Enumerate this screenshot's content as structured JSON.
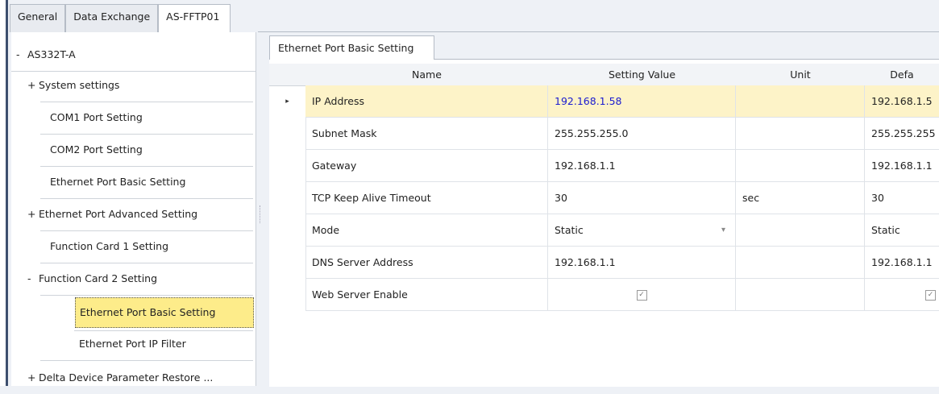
{
  "tabs": [
    "General",
    "Data Exchange",
    "AS-FFTP01"
  ],
  "tree": {
    "items": [
      {
        "prefix": "-",
        "label": "AS332T-A"
      },
      {
        "prefix": "+",
        "label": "System settings"
      },
      {
        "prefix": "",
        "label": "COM1 Port Setting"
      },
      {
        "prefix": "",
        "label": "COM2 Port Setting"
      },
      {
        "prefix": "",
        "label": "Ethernet Port Basic Setting"
      },
      {
        "prefix": "+",
        "label": "Ethernet Port Advanced Setting"
      },
      {
        "prefix": "",
        "label": "Function Card 1 Setting"
      },
      {
        "prefix": "-",
        "label": "Function Card 2 Setting"
      },
      {
        "prefix": "",
        "label": "Ethernet Port Basic Setting"
      },
      {
        "prefix": "",
        "label": "Ethernet Port IP Filter"
      },
      {
        "prefix": "+",
        "label": "Delta Device Parameter Restore ..."
      }
    ]
  },
  "panel": {
    "tab_label": "Ethernet Port Basic Setting",
    "columns": [
      "Name",
      "Setting Value",
      "Unit",
      "Defa"
    ],
    "rows": [
      {
        "name": "IP Address",
        "value": "192.168.1.58",
        "unit": "",
        "default": "192.168.1.5"
      },
      {
        "name": "Subnet Mask",
        "value": "255.255.255.0",
        "unit": "",
        "default": "255.255.255"
      },
      {
        "name": "Gateway",
        "value": "192.168.1.1",
        "unit": "",
        "default": "192.168.1.1"
      },
      {
        "name": "TCP Keep Alive Timeout",
        "value": "30",
        "unit": "sec",
        "default": "30"
      },
      {
        "name": "Mode",
        "value": "Static",
        "unit": "",
        "default": "Static"
      },
      {
        "name": "DNS Server Address",
        "value": "192.168.1.1",
        "unit": "",
        "default": "192.168.1.1"
      },
      {
        "name": "Web Server Enable",
        "value": "",
        "unit": "",
        "default": ""
      }
    ],
    "row_indicator": "▸",
    "dropdown_arrow": "▾",
    "check_glyph": "✓"
  },
  "colors": {
    "selected_row": "#fdf3c8",
    "selected_tree": "#fdec8a",
    "value_link": "#1a1ad0"
  }
}
